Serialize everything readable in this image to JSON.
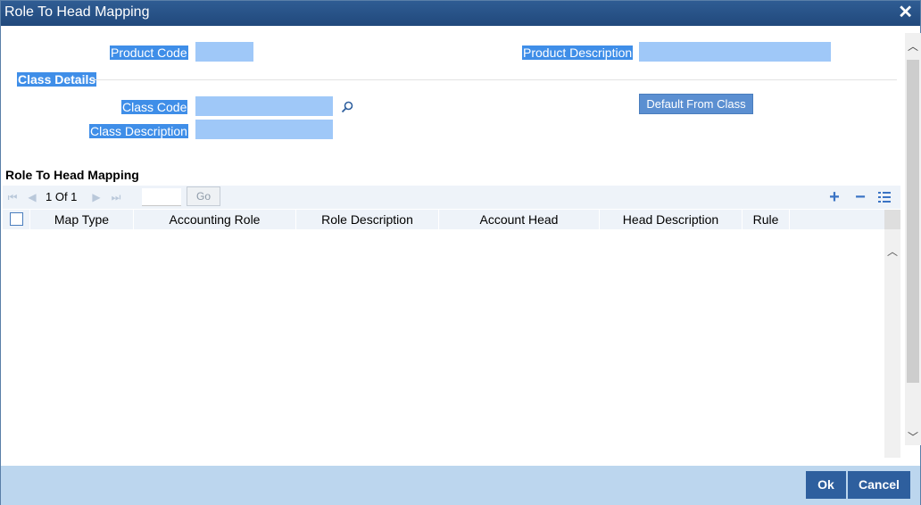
{
  "window": {
    "title": "Role To Head Mapping"
  },
  "form": {
    "product_code_label": "Product Code",
    "product_code_value": "",
    "product_description_label": "Product Description",
    "product_description_value": "",
    "class_details_label": "Class Details",
    "class_code_label": "Class Code",
    "class_code_value": "",
    "class_description_label": "Class Description",
    "class_description_value": "",
    "default_from_class_label": "Default From Class"
  },
  "mapping": {
    "title": "Role To Head Mapping",
    "pagination": {
      "text": "1 Of 1",
      "go_label": "Go",
      "page_input_value": ""
    },
    "columns": [
      "Map Type",
      "Accounting Role",
      "Role Description",
      "Account Head",
      "Head Description",
      "Rule"
    ],
    "rows": []
  },
  "footer": {
    "ok_label": "Ok",
    "cancel_label": "Cancel"
  },
  "icons": {
    "close": "close-icon",
    "lookup": "search-icon",
    "first": "first-page-icon",
    "prev": "prev-page-icon",
    "next": "next-page-icon",
    "last": "last-page-icon",
    "add": "plus-icon",
    "delete": "minus-icon",
    "view": "list-icon"
  },
  "colors": {
    "title_bar": "#21497c",
    "label_highlight": "#3f8ee8",
    "field_bg": "#9fc8f8",
    "footer_bg": "#bcd6ee",
    "button_bg": "#2e5f9e"
  }
}
